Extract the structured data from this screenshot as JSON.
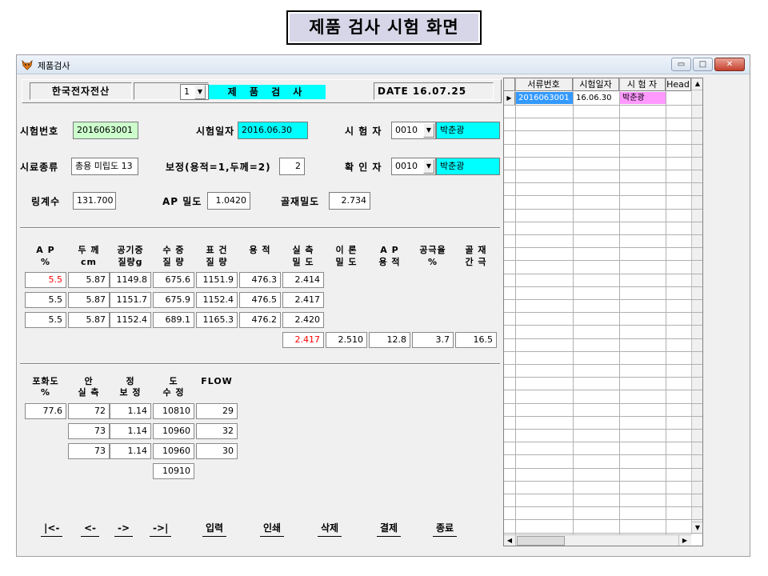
{
  "page_title": "제품 검사 시험 화면",
  "window": {
    "title": "제품검사",
    "min": "▭",
    "max": "□",
    "close": "✕"
  },
  "header": {
    "company": "한국전자전산",
    "combo_value": "1",
    "screen_label": "제 품 검 사",
    "date": "DATE 16.07.25"
  },
  "form": {
    "test_no_label": "시험번호",
    "test_no": "2016063001",
    "test_date_label": "시험일자",
    "test_date": "2016.06.30",
    "tester_label": "시 험 자",
    "tester_code": "0010",
    "tester_name": "박춘광",
    "sample_label": "시료종류",
    "sample": "총용 미립도 13",
    "correction_label": "보정(용적=1,두께=2)",
    "correction": "2",
    "confirmer_label": "확 인 자",
    "confirmer_code": "0010",
    "confirmer_name": "박춘광",
    "ring_label": "링계수",
    "ring": "131.700",
    "ap_density_label": "AP 밀도",
    "ap_density": "1.0420",
    "agg_density_label": "골재밀도",
    "agg_density": "2.734"
  },
  "table1": {
    "headers": [
      {
        "l1": "A P",
        "l2": "%"
      },
      {
        "l1": "두 께",
        "l2": "cm"
      },
      {
        "l1": "공기중",
        "l2": "질량g"
      },
      {
        "l1": "수 중",
        "l2": "질 량"
      },
      {
        "l1": "표 건",
        "l2": "질 량"
      },
      {
        "l1": "용 적",
        "l2": ""
      },
      {
        "l1": "실 측",
        "l2": "밀 도"
      },
      {
        "l1": "이 론",
        "l2": "밀 도"
      },
      {
        "l1": "A P",
        "l2": "용 적"
      },
      {
        "l1": "공극율",
        "l2": "%"
      },
      {
        "l1": "골 재",
        "l2": "간 극"
      }
    ],
    "rows": [
      [
        "5.5",
        "5.87",
        "1149.8",
        "675.6",
        "1151.9",
        "476.3",
        "2.414"
      ],
      [
        "5.5",
        "5.87",
        "1151.7",
        "675.9",
        "1152.4",
        "476.5",
        "2.417"
      ],
      [
        "5.5",
        "5.87",
        "1152.4",
        "689.1",
        "1165.3",
        "476.2",
        "2.420"
      ]
    ],
    "summary": [
      "2.417",
      "2.510",
      "12.8",
      "3.7",
      "16.5"
    ]
  },
  "table2": {
    "headers": [
      {
        "l1": "포화도",
        "l2": "%"
      },
      {
        "l1": "안",
        "l2": "실 측"
      },
      {
        "l1": "정",
        "l2": "보 정"
      },
      {
        "l1": "도",
        "l2": "수 정"
      },
      {
        "l1": "FLOW",
        "l2": ""
      }
    ],
    "saturation": "77.6",
    "rows": [
      [
        "72",
        "1.14",
        "10810",
        "29"
      ],
      [
        "73",
        "1.14",
        "10960",
        "32"
      ],
      [
        "73",
        "1.14",
        "10960",
        "30"
      ]
    ],
    "avg": "10910"
  },
  "nav": [
    "|<-",
    "<-",
    "->",
    "->|",
    "입력",
    "인쇄",
    "삭제",
    "결제",
    "종료"
  ],
  "grid": {
    "columns": [
      "서류번호",
      "시험일자",
      "시 험 자",
      "Head"
    ],
    "rows": [
      [
        "2016063001",
        "16.06.30",
        "박춘광",
        ""
      ]
    ]
  },
  "colors": {
    "cyan": "#00ffff",
    "green_field": "#ccffcc",
    "pink": "#ff99ff",
    "selected": "#3399ff",
    "red_text": "#ff0000"
  }
}
